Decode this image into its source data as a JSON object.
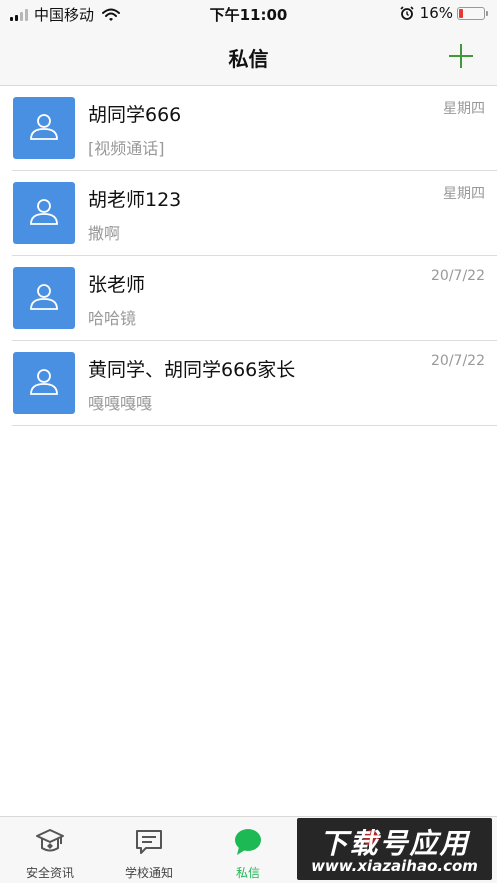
{
  "status_bar": {
    "carrier": "中国移动",
    "time": "下午11:00",
    "battery": "16%",
    "battery_level": 0.16,
    "battery_color": "#e53935",
    "icons": [
      "signal-icon",
      "wifi-icon",
      "alarm-icon",
      "battery-icon"
    ]
  },
  "nav": {
    "title": "私信",
    "add_icon": "plus-icon",
    "accent_color": "#3f9a3a"
  },
  "messages": [
    {
      "name": "胡同学666",
      "preview": "[视频通话]",
      "time": "星期四"
    },
    {
      "name": "胡老师123",
      "preview": "撒啊",
      "time": "星期四"
    },
    {
      "name": "张老师",
      "preview": "哈哈镜",
      "time": "20/7/22"
    },
    {
      "name": "黄同学、胡同学666家长",
      "preview": "嘎嘎嘎嘎",
      "time": "20/7/22"
    }
  ],
  "avatar_color": "#4a90e2",
  "tabs": [
    {
      "label": "安全资讯",
      "icon": "graduation-cap-icon",
      "active": false
    },
    {
      "label": "学校通知",
      "icon": "notice-chat-icon",
      "active": false
    },
    {
      "label": "私信",
      "icon": "message-bubble-icon",
      "active": true
    }
  ],
  "active_tab_color": "#1db954",
  "watermark": {
    "line1": "下载号应用",
    "line2": "www.xiazaihao.com"
  }
}
